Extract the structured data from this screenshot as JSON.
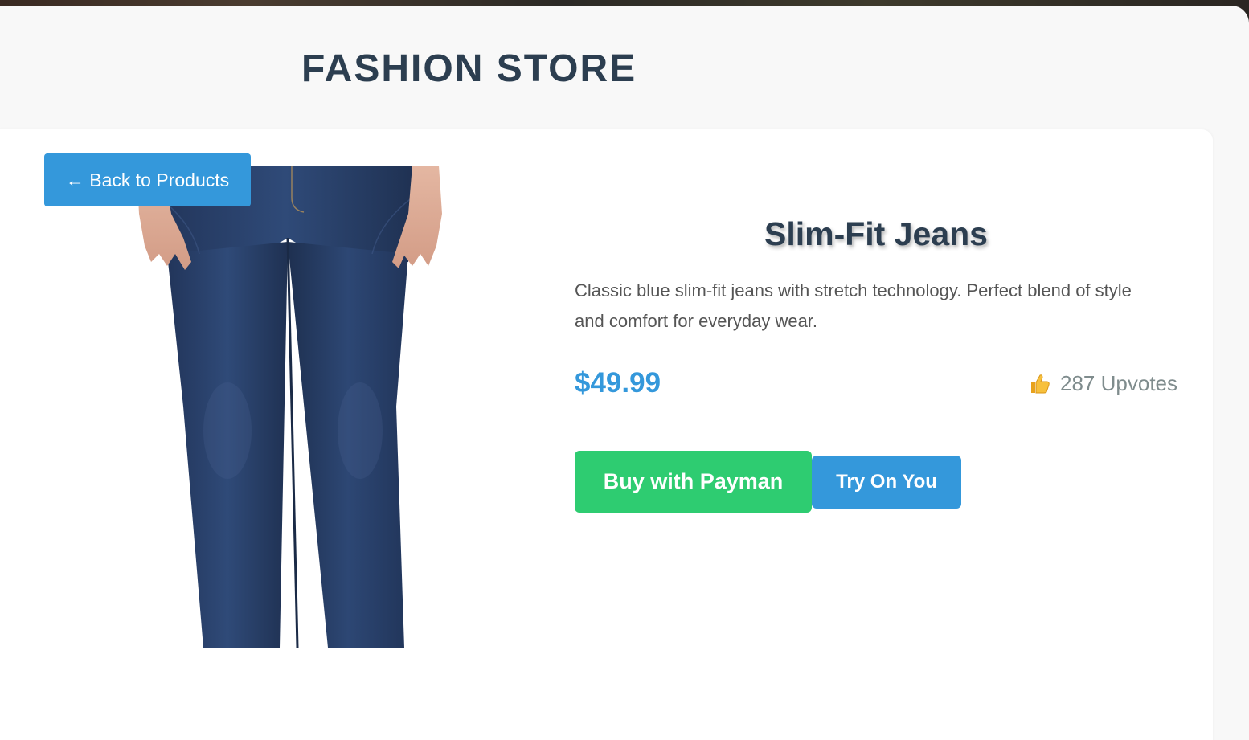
{
  "header": {
    "store_title": "FASHION STORE"
  },
  "nav": {
    "back_label": "← Back to Products"
  },
  "product": {
    "name": "Slim-Fit Jeans",
    "description": "Classic blue slim-fit jeans with stretch technology. Perfect blend of style and comfort for everyday wear.",
    "price": "$49.99",
    "upvotes_label": "287 Upvotes",
    "upvotes_icon": "thumbs-up-icon",
    "image_icon": "jeans-product-photo"
  },
  "actions": {
    "buy_label": "Buy with Payman",
    "try_label": "Try On You"
  },
  "colors": {
    "title": "#2c3e50",
    "accent_blue": "#3498db",
    "accent_green": "#2ecc71",
    "muted_text": "#7f8c8d",
    "body_text": "#555555"
  }
}
